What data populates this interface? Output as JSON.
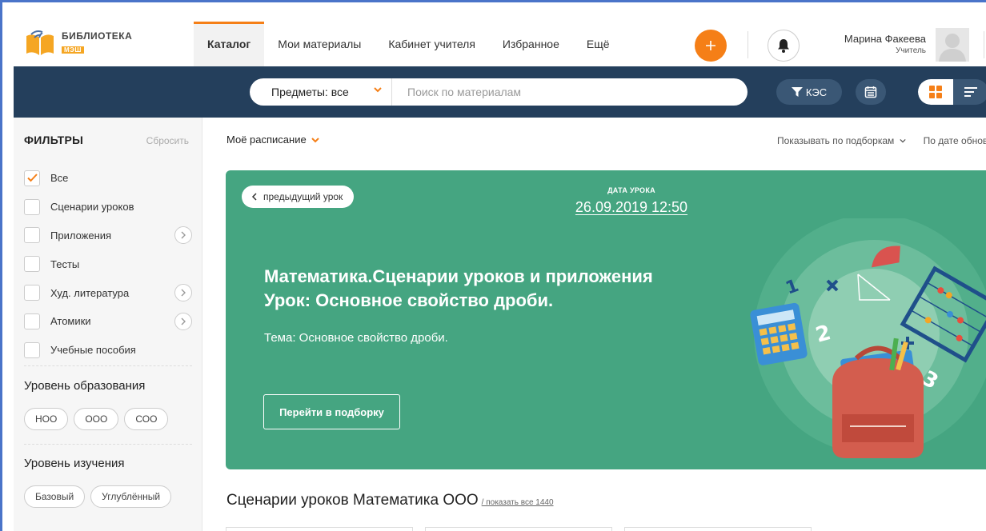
{
  "logo": {
    "title": "БИБЛИОТЕКА",
    "subtitle": "МЭШ"
  },
  "nav": {
    "items": [
      {
        "label": "Каталог",
        "active": true
      },
      {
        "label": "Мои материалы",
        "active": false
      },
      {
        "label": "Кабинет учителя",
        "active": false
      },
      {
        "label": "Избранное",
        "active": false
      },
      {
        "label": "Ещё",
        "active": false
      }
    ]
  },
  "header": {
    "plus_icon": "plus-icon",
    "bell_icon": "bell-icon",
    "user_name": "Марина Факеева",
    "user_role": "Учитель"
  },
  "search": {
    "subjects_label": "Предметы: все",
    "placeholder": "Поиск по материалам",
    "value": "",
    "kes_label": "КЭС"
  },
  "colors": {
    "accent": "#f57f17",
    "navbar_dark": "#243f5c",
    "banner_green": "#45a581"
  },
  "sidebar": {
    "title": "ФИЛЬТРЫ",
    "reset": "Сбросить",
    "filters": [
      {
        "label": "Все",
        "checked": true,
        "expandable": false
      },
      {
        "label": "Сценарии уроков",
        "checked": false,
        "expandable": false
      },
      {
        "label": "Приложения",
        "checked": false,
        "expandable": true
      },
      {
        "label": "Тесты",
        "checked": false,
        "expandable": false
      },
      {
        "label": "Худ. литература",
        "checked": false,
        "expandable": true
      },
      {
        "label": "Атомики",
        "checked": false,
        "expandable": true
      },
      {
        "label": "Учебные пособия",
        "checked": false,
        "expandable": false
      }
    ],
    "education_level": {
      "title": "Уровень образования",
      "options": [
        "НОО",
        "ООО",
        "СОО"
      ]
    },
    "study_level": {
      "title": "Уровень изучения",
      "options": [
        "Базовый",
        "Углублённый"
      ]
    }
  },
  "main": {
    "schedule_label": "Моё расписание",
    "sort_by_collections": "Показывать по подборкам",
    "sort_by_date": "По дате обнов"
  },
  "banner": {
    "prev_label": "предыдущий урок",
    "date_label": "ДАТА УРОКА",
    "date_value": "26.09.2019 12:50",
    "title_line1": "Математика.Сценарии уроков и приложения",
    "title_line2": "Урок: Основное свойство дроби.",
    "topic": "Тема: Основное свойство дроби.",
    "button_label": "Перейти в подборку"
  },
  "section": {
    "heading": "Сценарии уроков Математика ООО",
    "show_all": "/ показать все 1440"
  }
}
